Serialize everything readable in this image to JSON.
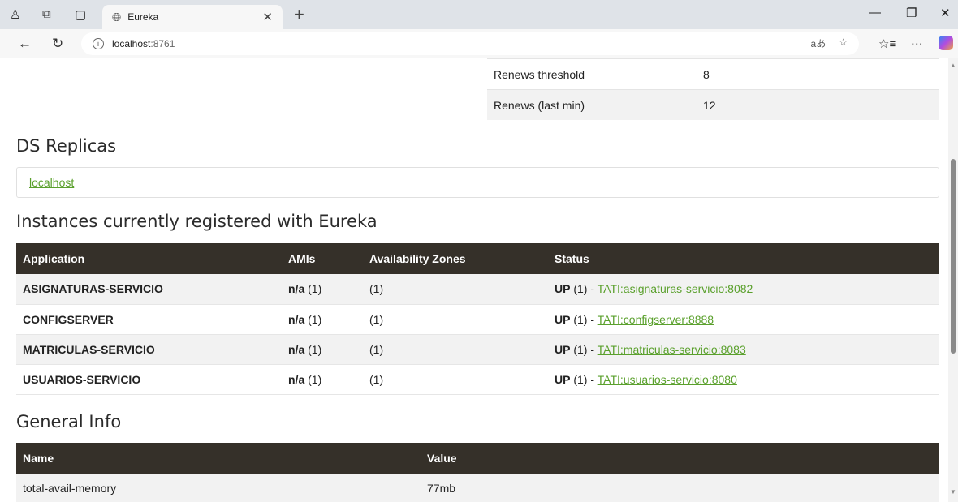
{
  "browser": {
    "tab_title": "Eureka",
    "address_host": "localhost",
    "address_port": ":8761",
    "read_aloud_label": "aあ"
  },
  "lease_info": [
    {
      "key": "Renews threshold",
      "value": "8"
    },
    {
      "key": "Renews (last min)",
      "value": "12"
    }
  ],
  "replicas": {
    "heading": "DS Replicas",
    "items": [
      "localhost"
    ]
  },
  "instances": {
    "heading": "Instances currently registered with Eureka",
    "columns": [
      "Application",
      "AMIs",
      "Availability Zones",
      "Status"
    ],
    "rows": [
      {
        "application": "ASIGNATURAS-SERVICIO",
        "amis_bold": "n/a",
        "amis_count": "(1)",
        "zones": "(1)",
        "status_bold": "UP",
        "status_count": "(1) - ",
        "status_link": "TATI:asignaturas-servicio:8082"
      },
      {
        "application": "CONFIGSERVER",
        "amis_bold": "n/a",
        "amis_count": "(1)",
        "zones": "(1)",
        "status_bold": "UP",
        "status_count": "(1) - ",
        "status_link": "TATI:configserver:8888"
      },
      {
        "application": "MATRICULAS-SERVICIO",
        "amis_bold": "n/a",
        "amis_count": "(1)",
        "zones": "(1)",
        "status_bold": "UP",
        "status_count": "(1) - ",
        "status_link": "TATI:matriculas-servicio:8083"
      },
      {
        "application": "USUARIOS-SERVICIO",
        "amis_bold": "n/a",
        "amis_count": "(1)",
        "zones": "(1)",
        "status_bold": "UP",
        "status_count": "(1) - ",
        "status_link": "TATI:usuarios-servicio:8080"
      }
    ]
  },
  "general_info": {
    "heading": "General Info",
    "columns": [
      "Name",
      "Value"
    ],
    "rows": [
      {
        "name": "total-avail-memory",
        "value": "77mb"
      }
    ]
  },
  "colors": {
    "table_header": "#353029",
    "link": "#5aa02c",
    "alt_row": "#f2f2f2"
  }
}
